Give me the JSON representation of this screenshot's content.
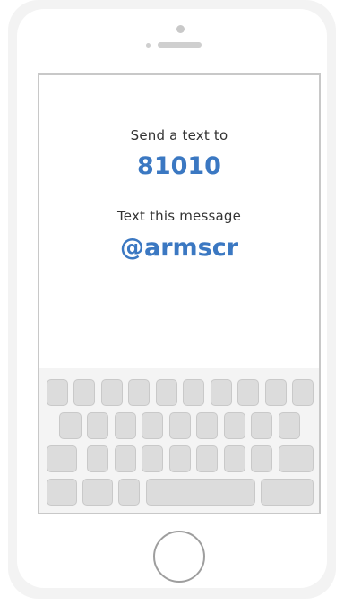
{
  "screen": {
    "instruction_1": "Send a text to",
    "phone_number": "81010",
    "instruction_2": "Text this message",
    "message_code": "@armscr"
  },
  "colors": {
    "accent": "#3b78c2",
    "text": "#333333",
    "key_fill": "#dcdcdc",
    "phone_body": "#f3f3f3"
  }
}
